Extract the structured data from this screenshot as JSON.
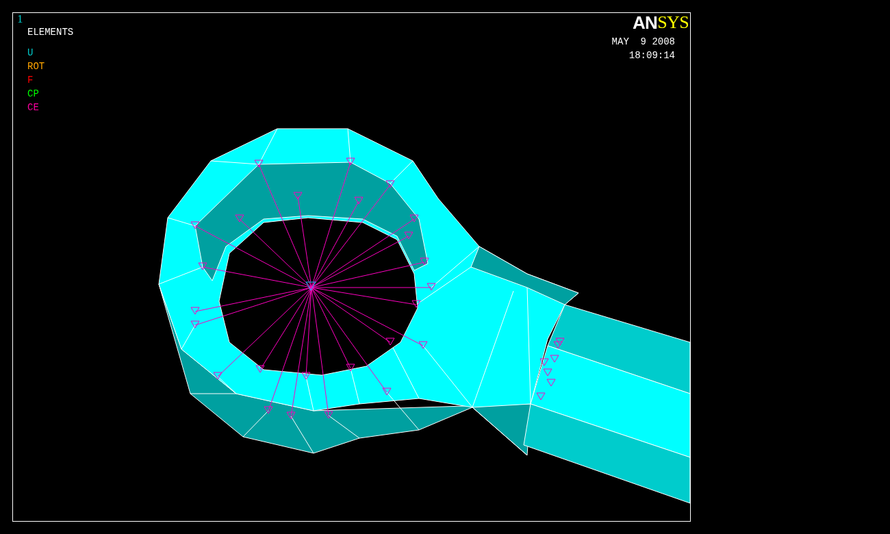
{
  "window_number": "1",
  "plot_title": "ELEMENTS",
  "legend": [
    {
      "label": "U",
      "color": "#00c8c8"
    },
    {
      "label": "ROT",
      "color": "#ffa500"
    },
    {
      "label": "F",
      "color": "#ff0000"
    },
    {
      "label": "CP",
      "color": "#00ff00"
    },
    {
      "label": "CE",
      "color": "#ff00a0"
    }
  ],
  "logo": {
    "part_1": "AN",
    "part_2": "SYS"
  },
  "date": "MAY  9 2008",
  "time": "18:09:14"
}
